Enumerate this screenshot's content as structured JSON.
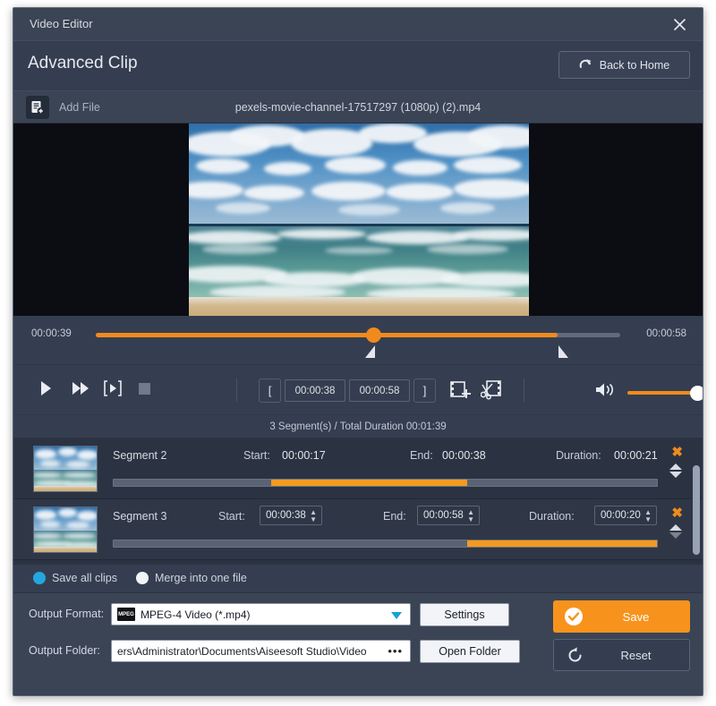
{
  "window": {
    "title": "Video Editor",
    "close_icon": "close-icon"
  },
  "header": {
    "heading": "Advanced Clip",
    "back_home_label": "Back to Home",
    "back_home_icon": "redo-arrow-icon"
  },
  "filebar": {
    "add_file_label": "Add File",
    "add_file_icon": "add-file-icon",
    "filename": "pexels-movie-channel-17517297 (1080p) (2).mp4"
  },
  "timeline": {
    "current_time": "00:00:39",
    "total_time": "00:00:58",
    "playhead_percent": 53,
    "fill_percent": 88,
    "trim_start_percent": 53,
    "trim_end_percent": 88
  },
  "controls": {
    "play_icon": "play-icon",
    "fast_forward_icon": "fast-forward-icon",
    "frame_step_icon": "frame-step-icon",
    "stop_icon": "stop-icon",
    "mark_in_icon": "mark-in-bracket-icon",
    "mark_out_icon": "mark-out-bracket-icon",
    "clip_start": "00:00:38",
    "clip_end": "00:00:58",
    "add_segment_icon": "add-clip-icon",
    "split_icon": "split-scissors-icon",
    "volume_icon": "volume-icon",
    "volume_percent": 100
  },
  "segments_summary": "3 Segment(s) / Total Duration 00:01:39",
  "segments": [
    {
      "name": "Segment 2",
      "start_label": "Start:",
      "start_value": "00:00:17",
      "end_label": "End:",
      "end_value": "00:00:38",
      "duration_label": "Duration:",
      "duration_value": "00:00:21",
      "editable": false,
      "bar_start_percent": 29,
      "bar_end_percent": 65,
      "delete_icon": "delete-x-icon",
      "move_up_icon": "move-up-icon",
      "move_down_icon": "move-down-icon"
    },
    {
      "name": "Segment 3",
      "start_label": "Start:",
      "start_value": "00:00:38",
      "end_label": "End:",
      "end_value": "00:00:58",
      "duration_label": "Duration:",
      "duration_value": "00:00:20",
      "editable": true,
      "bar_start_percent": 65,
      "bar_end_percent": 100,
      "delete_icon": "delete-x-icon",
      "move_up_icon": "move-up-icon",
      "move_down_icon": "move-down-icon"
    }
  ],
  "save_mode": {
    "option_all_label": "Save all clips",
    "option_merge_label": "Merge into one file",
    "selected": "Save all clips"
  },
  "output": {
    "format_label": "Output Format:",
    "format_value": "MPEG-4 Video (*.mp4)",
    "format_icon": "mpeg-film-icon",
    "settings_label": "Settings",
    "folder_label": "Output Folder:",
    "folder_value": "ers\\Administrator\\Documents\\Aiseesoft Studio\\Video",
    "browse_label": "•••",
    "open_folder_label": "Open Folder",
    "save_label": "Save",
    "save_icon": "check-circle-icon",
    "reset_label": "Reset",
    "reset_icon": "reset-circular-arrow-icon"
  },
  "colors": {
    "accent_orange": "#f08a1e",
    "accent_blue": "#24a7e0",
    "panel_bg": "#353e50",
    "list_bg": "#2b3342"
  }
}
